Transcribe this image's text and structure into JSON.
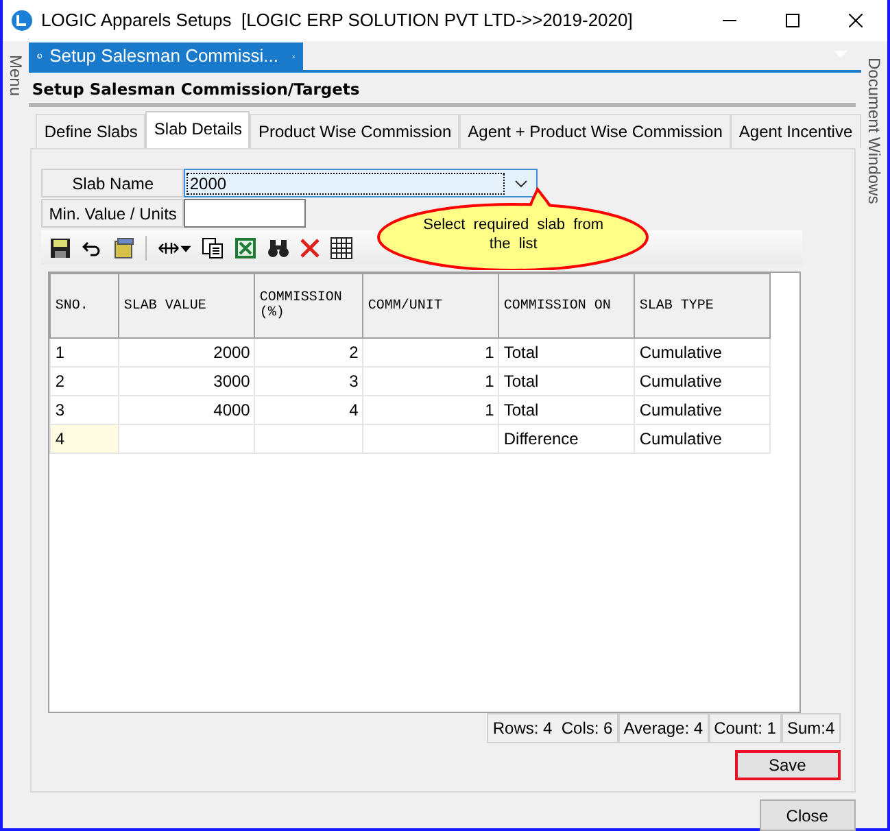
{
  "window": {
    "title": "LOGIC Apparels Setups  [LOGIC ERP SOLUTION PVT LTD->>2019-2020]"
  },
  "side_panels": {
    "left": "Menu",
    "right": "Document Windows"
  },
  "document_tab": {
    "label": "Setup Salesman Commissi...",
    "selected": true
  },
  "form_title": "Setup Salesman Commission/Targets",
  "tabs": [
    {
      "label": "Define Slabs",
      "selected": false
    },
    {
      "label": "Slab Details",
      "selected": true
    },
    {
      "label": "Product Wise Commission",
      "selected": false
    },
    {
      "label": "Agent + Product Wise Commission",
      "selected": false
    },
    {
      "label": "Agent Incentive",
      "selected": false
    }
  ],
  "fields": [
    {
      "label": "Slab Name",
      "kind": "dropdown",
      "value": "2000"
    },
    {
      "label": "Min. Value / Units",
      "kind": "text"
    }
  ],
  "tooltip": "Select  required  slab  from  the  list",
  "table": {
    "columns": [
      {
        "label": "SNO."
      },
      {
        "label": "SLAB VALUE"
      },
      {
        "label": "COMMISSION (%)"
      },
      {
        "label": "COMM/UNIT"
      },
      {
        "label": "COMMISSION ON"
      },
      {
        "label": "SLAB TYPE"
      }
    ],
    "rows": [
      {
        "cells": [
          "1",
          "2000",
          "2",
          "1",
          "Total",
          "Cumulative"
        ],
        "current": false
      },
      {
        "cells": [
          "2",
          "3000",
          "3",
          "1",
          "Total",
          "Cumulative"
        ],
        "current": false
      },
      {
        "cells": [
          "3",
          "4000",
          "4",
          "1",
          "Total",
          "Cumulative"
        ],
        "current": false
      },
      {
        "cells": [
          "4",
          null,
          null,
          null,
          "Difference",
          "Cumulative"
        ],
        "current": true
      }
    ]
  },
  "status_bar": [
    "Rows: 4  Cols: 6",
    "Average: 4",
    "Count: 1",
    "Sum:4"
  ],
  "save_button": {
    "label": "Save",
    "highlighted": true
  },
  "close_button": {
    "label": "Close"
  }
}
